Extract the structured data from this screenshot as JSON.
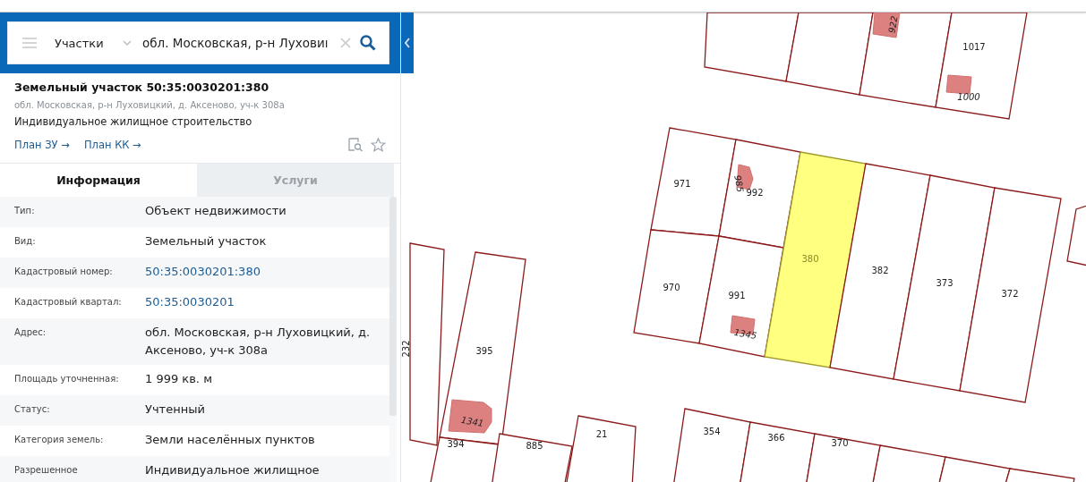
{
  "search": {
    "category": "Участки",
    "value": "обл. Московская, р-н Луховиı"
  },
  "object": {
    "title": "Земельный участок 50:35:0030201:380",
    "address": "обл. Московская, р-н Луховицкий, д. Аксеново, уч-к 308а",
    "purpose": "Индивидуальное жилищное строительство",
    "links": [
      "План ЗУ →",
      "План КК →"
    ],
    "favorite": false
  },
  "tabs": [
    {
      "label": "Информация",
      "selected": true
    },
    {
      "label": "Услуги",
      "selected": false
    }
  ],
  "properties": [
    {
      "label": "Тип:",
      "value": "Объект недвижимости",
      "kind": "text"
    },
    {
      "label": "Вид:",
      "value": "Земельный участок",
      "kind": "text"
    },
    {
      "label": "Кадастровый номер:",
      "value": "50:35:0030201:380",
      "kind": "link"
    },
    {
      "label": "Кадастровый квартал:",
      "value": "50:35:0030201",
      "kind": "link"
    },
    {
      "label": "Адрес:",
      "value": "обл. Московская, р-н Луховицкий, д. Аксеново, уч-к 308а",
      "kind": "text"
    },
    {
      "label": "Площадь уточненная:",
      "value": "1 999 кв. м",
      "kind": "text"
    },
    {
      "label": "Статус:",
      "value": "Учтенный",
      "kind": "text"
    },
    {
      "label": "Категория земель:",
      "value": "Земли населённых пунктов",
      "kind": "text"
    },
    {
      "label": "Разрешенное",
      "value": "Индивидуальное жилищное",
      "kind": "text"
    }
  ],
  "map": {
    "parcels": [
      {
        "label": "1017",
        "selected": false
      },
      {
        "label": "971",
        "selected": false
      },
      {
        "label": "992",
        "selected": false
      },
      {
        "label": "970",
        "selected": false
      },
      {
        "label": "991",
        "selected": false
      },
      {
        "label": "380",
        "selected": true
      },
      {
        "label": "382",
        "selected": false
      },
      {
        "label": "373",
        "selected": false
      },
      {
        "label": "372",
        "selected": false
      },
      {
        "label": "232",
        "selected": false
      },
      {
        "label": "395",
        "selected": false
      },
      {
        "label": "394",
        "selected": false
      },
      {
        "label": "885",
        "selected": false
      },
      {
        "label": "21",
        "selected": false
      },
      {
        "label": "354",
        "selected": false
      },
      {
        "label": "366",
        "selected": false
      },
      {
        "label": "370",
        "selected": false
      }
    ],
    "buildings": [
      {
        "label": "922"
      },
      {
        "label": "1000"
      },
      {
        "label": "985"
      },
      {
        "label": "1345"
      },
      {
        "label": "1341"
      }
    ]
  }
}
